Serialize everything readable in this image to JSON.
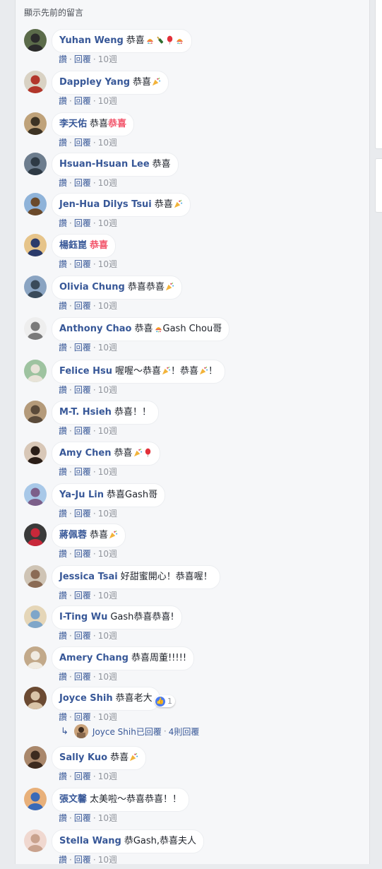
{
  "show_previous": "顯示先前的留言",
  "actions": {
    "like": "讚",
    "reply": "回覆",
    "sep": "·"
  },
  "comments": [
    {
      "name": "Yuhan Weng",
      "text": "恭喜",
      "emojis": [
        "party-hat",
        "bottle",
        "balloon",
        "party-hat"
      ],
      "time": "10週"
    },
    {
      "name": "Dappley Yang",
      "text": "恭喜",
      "emojis": [
        "party-popper"
      ],
      "time": "10週"
    },
    {
      "name": "李天佑",
      "text": "恭喜",
      "accent": "恭喜",
      "emojis": [],
      "time": "10週"
    },
    {
      "name": "Hsuan-Hsuan Lee",
      "text": "恭喜",
      "emojis": [],
      "time": "10週"
    },
    {
      "name": "Jen-Hua Dilys Tsui",
      "text": "恭喜",
      "emojis": [
        "party-popper"
      ],
      "time": "10週"
    },
    {
      "name": "楊鈺崑",
      "text": "",
      "accent": "恭喜",
      "emojis": [],
      "time": "10週"
    },
    {
      "name": "Olivia Chung",
      "text": "恭喜恭喜",
      "emojis": [
        "party-popper"
      ],
      "time": "10週"
    },
    {
      "name": "Anthony Chao",
      "text": "恭喜",
      "emojis": [
        "party-hat"
      ],
      "after": "Gash Chou哥",
      "time": "10週"
    },
    {
      "name": "Felice Hsu",
      "text": "喔喔～恭喜",
      "emojis": [
        "party-popper"
      ],
      "after": "！恭喜",
      "emojis2": [
        "party-popper"
      ],
      "tail": "！",
      "time": "10週"
    },
    {
      "name": "M-T. Hsieh",
      "text": "恭喜！！",
      "emojis": [],
      "time": "10週"
    },
    {
      "name": "Amy Chen",
      "text": "恭喜",
      "emojis": [
        "party-popper",
        "balloon"
      ],
      "time": "10週"
    },
    {
      "name": "Ya-Ju Lin",
      "text": "恭喜Gash哥",
      "emojis": [],
      "time": "10週"
    },
    {
      "name": "蔣佩蓉",
      "text": "恭喜",
      "emojis": [
        "party-popper"
      ],
      "time": "10週"
    },
    {
      "name": "Jessica Tsai",
      "text": "好甜蜜開心！恭喜喔！",
      "emojis": [],
      "time": "10週"
    },
    {
      "name": "I-Ting Wu",
      "text": "Gash恭喜恭喜!",
      "emojis": [],
      "time": "10週"
    },
    {
      "name": "Amery Chang",
      "text": "恭喜周董!!!!!",
      "emojis": [],
      "time": "10週"
    },
    {
      "name": "Joyce Shih",
      "text": "恭喜老大",
      "emojis": [],
      "time": "10週",
      "reaction_count": "1"
    },
    {
      "name": "Sally Kuo",
      "text": "恭喜",
      "emojis": [
        "party-popper"
      ],
      "time": "10週"
    },
    {
      "name": "張文馨",
      "text": "太美啦～恭喜恭喜！！",
      "emojis": [],
      "time": "10週"
    },
    {
      "name": "Stella Wang",
      "text": "恭Gash,恭喜夫人",
      "emojis": [],
      "time": "10週"
    }
  ],
  "reply_summary": {
    "name_text": "Joyce Shih已回覆",
    "sep": "·",
    "count_text": "4則回覆"
  },
  "colors": {
    "link": "#385898",
    "meta": "#90949c",
    "accent": "#f25268",
    "bg": "#f6f7f9"
  }
}
